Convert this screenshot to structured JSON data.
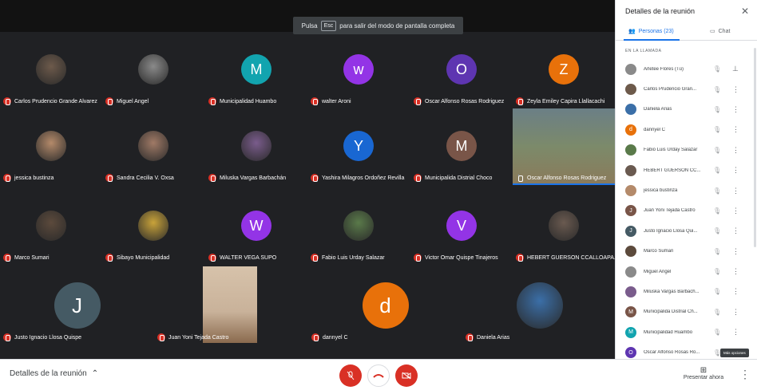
{
  "fullscreen_hint": {
    "prefix": "Pulsa",
    "key": "Esc",
    "suffix": "para salir del modo de pantalla completa"
  },
  "tiles": [
    {
      "name": "Carlos Prudencio Grande Alvarez",
      "kind": "photo",
      "color": "#6d5a4b"
    },
    {
      "name": "Miguel Angel",
      "kind": "photo",
      "color": "#8a8a8a"
    },
    {
      "name": "Municipalidad Huambo",
      "kind": "letter",
      "letter": "M",
      "color": "#12a4af"
    },
    {
      "name": "walter Aroni",
      "kind": "letter",
      "letter": "w",
      "color": "#9334e6"
    },
    {
      "name": "Oscar Alfonso Rosas Rodriguez",
      "kind": "letter",
      "letter": "O",
      "color": "#5e35b1"
    },
    {
      "name": "Zeyla Emiley Capira Llallacachi",
      "kind": "letter",
      "letter": "Z",
      "color": "#e8710a"
    },
    {
      "name": "jessica bustinza",
      "kind": "photo",
      "color": "#b48a6a"
    },
    {
      "name": "Sandra Cecilia V. Oxsa",
      "kind": "photo",
      "color": "#a07a66"
    },
    {
      "name": "Miluska Vargas Barbachán",
      "kind": "photo",
      "color": "#7a5c8c"
    },
    {
      "name": "Yashira Milagros Ordoñez Revilla",
      "kind": "letter",
      "letter": "Y",
      "color": "#1967d2"
    },
    {
      "name": "Municipalida Distrial Choco",
      "kind": "letter",
      "letter": "M",
      "color": "#795548"
    },
    {
      "name": "Oscar Alfonso Rosas Rodriguez",
      "kind": "video",
      "color": "#7b8a6a"
    },
    {
      "name": "Marco Sumari",
      "kind": "photo",
      "color": "#5c4a3c"
    },
    {
      "name": "Sibayo Municipalidad",
      "kind": "photo",
      "color": "#c9a33a"
    },
    {
      "name": "WALTER VEGA SUPO",
      "kind": "letter",
      "letter": "W",
      "color": "#9334e6"
    },
    {
      "name": "Fabio Luis Urday Salazar",
      "kind": "photo",
      "color": "#5a7a4a"
    },
    {
      "name": "Victor Omar Quispe Tinajeros",
      "kind": "letter",
      "letter": "V",
      "color": "#9334e6"
    },
    {
      "name": "HEBERT GUERSON CCALLOAPA...",
      "kind": "photo",
      "color": "#6a5a50"
    },
    {
      "name": "Justo Ignacio Llosa Quispe",
      "kind": "letter",
      "letter": "J",
      "color": "#455a64"
    },
    {
      "name": "Juan Yoni Tejada Castro",
      "kind": "video",
      "color": "#c9b29a"
    },
    {
      "name": "dannyel C",
      "kind": "letter",
      "letter": "d",
      "color": "#e8710a"
    },
    {
      "name": "Daniela Arias",
      "kind": "photo",
      "color": "#3b6fa8"
    }
  ],
  "panel": {
    "title": "Detalles de la reunión",
    "tab_people": "Personas (23)",
    "tab_chat": "Chat",
    "section": "EN LA LLAMADA",
    "people": [
      {
        "name": "Arletee Flores (Tú)",
        "letter": "",
        "color": "#8a8a8a",
        "pin": true
      },
      {
        "name": "Carlos Prudencio Gran...",
        "letter": "",
        "color": "#6d5a4b"
      },
      {
        "name": "Daniela Arias",
        "letter": "",
        "color": "#3b6fa8"
      },
      {
        "name": "dannyel C",
        "letter": "d",
        "color": "#e8710a"
      },
      {
        "name": "Fabio Luis Urday Salazar",
        "letter": "",
        "color": "#5a7a4a"
      },
      {
        "name": "HEBERT GUERSON CC...",
        "letter": "",
        "color": "#6a5a50"
      },
      {
        "name": "jessica bustinza",
        "letter": "",
        "color": "#b48a6a"
      },
      {
        "name": "Juan Yoni Tejada Castro",
        "letter": "J",
        "color": "#795548"
      },
      {
        "name": "Justo Ignacio Llosa Qui...",
        "letter": "J",
        "color": "#455a64"
      },
      {
        "name": "Marco Sumari",
        "letter": "",
        "color": "#5c4a3c"
      },
      {
        "name": "Miguel Angel",
        "letter": "",
        "color": "#8a8a8a"
      },
      {
        "name": "Miluska Vargas Barbach...",
        "letter": "",
        "color": "#7a5c8c"
      },
      {
        "name": "Municipalida Distrial Ch...",
        "letter": "M",
        "color": "#795548"
      },
      {
        "name": "Municipalidad Huambo",
        "letter": "M",
        "color": "#12a4af"
      },
      {
        "name": "Oscar Alfonso Rosas Ro...",
        "letter": "O",
        "color": "#5e35b1"
      }
    ]
  },
  "tooltip": "Más opciones",
  "bottom": {
    "details": "Detalles de la reunión",
    "present": "Presentar ahora"
  }
}
